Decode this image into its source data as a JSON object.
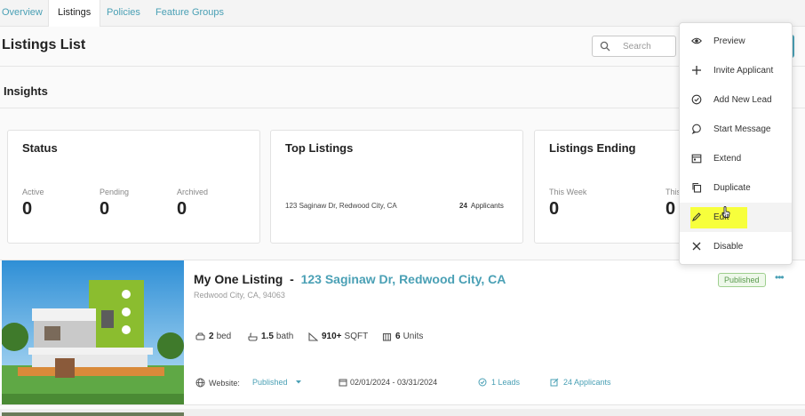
{
  "tabs": [
    {
      "label": "Overview",
      "active": false
    },
    {
      "label": "Listings",
      "active": true
    },
    {
      "label": "Policies",
      "active": false
    },
    {
      "label": "Feature Groups",
      "active": false
    }
  ],
  "page_title": "Listings List",
  "search": {
    "placeholder": "Search"
  },
  "insights": {
    "title": "Insights",
    "status": {
      "title": "Status",
      "stats": [
        {
          "label": "Active",
          "value": "0"
        },
        {
          "label": "Pending",
          "value": "0"
        },
        {
          "label": "Archived",
          "value": "0"
        }
      ]
    },
    "top_listings": {
      "title": "Top Listings",
      "address": "123 Saginaw Dr, Redwood City, CA",
      "count": "24",
      "count_label": "Applicants"
    },
    "listings_ending": {
      "title": "Listings Ending",
      "stats": [
        {
          "label": "This Week",
          "value": "0"
        },
        {
          "label": "This",
          "value": "0"
        }
      ]
    }
  },
  "listing": {
    "name": "My One Listing",
    "separator": "-",
    "address": "123 Saginaw Dr, Redwood City, CA",
    "subaddress": "Redwood City, CA, 94063",
    "status": "Published",
    "beds_value": "2",
    "beds_unit": "bed",
    "baths_value": "1.5",
    "baths_unit": "bath",
    "sqft_value": "910+",
    "sqft_unit": "SQFT",
    "units_value": "6",
    "units_unit": "Units",
    "website_label": "Website:",
    "website_status": "Published",
    "date_range": "02/01/2024 - 03/31/2024",
    "leads": "1 Leads",
    "applicants": "24 Applicants"
  },
  "menu": {
    "items": [
      {
        "label": "Preview",
        "icon": "eye-icon"
      },
      {
        "label": "Invite Applicant",
        "icon": "plus-icon"
      },
      {
        "label": "Add New Lead",
        "icon": "check-circle-icon"
      },
      {
        "label": "Start Message",
        "icon": "chat-bubble-icon"
      },
      {
        "label": "Extend",
        "icon": "calendar-icon"
      },
      {
        "label": "Duplicate",
        "icon": "copy-icon"
      },
      {
        "label": "Edit",
        "icon": "pencil-icon"
      },
      {
        "label": "Disable",
        "icon": "x-icon"
      }
    ],
    "hovered": "Edit",
    "highlight_color": "#f7ff3c"
  },
  "colors": {
    "accent": "#4aa0b5",
    "published_badge": "#5a9a4e"
  }
}
